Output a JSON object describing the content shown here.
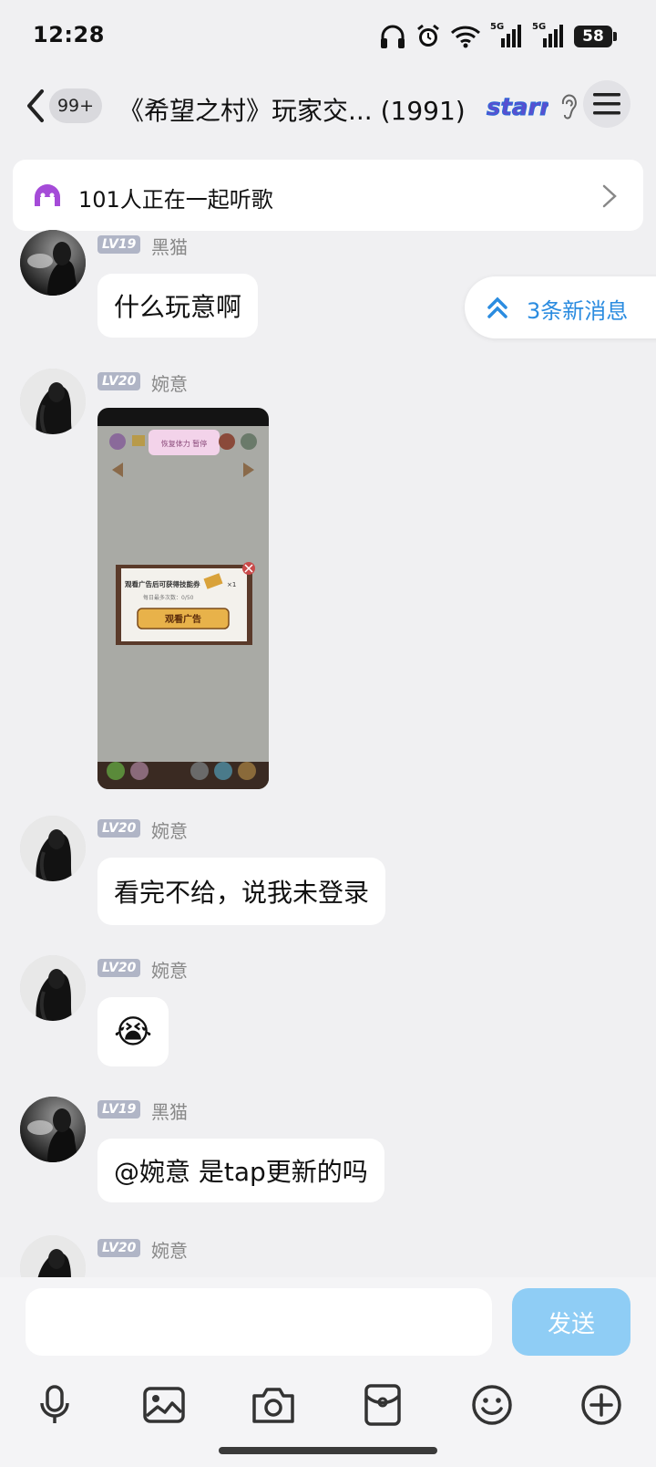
{
  "status_bar": {
    "time": "12:28",
    "network_1": "5G",
    "network_2": "5G",
    "battery": "58"
  },
  "header": {
    "unread_count": "99+",
    "title": "《希望之村》玩家交...   (1991)",
    "badge_text": "starry"
  },
  "listen_banner": {
    "text": "101人正在一起听歌"
  },
  "new_messages": {
    "text": "3条新消息"
  },
  "messages": [
    {
      "level": "LV19",
      "sender": "黑猫",
      "text": "什么玩意啊"
    },
    {
      "level": "LV20",
      "sender": "婉意",
      "image_caption": "观看广告后可获得技能券",
      "image_subcaption": "每日最多次数：0/50",
      "image_button": "观看广告",
      "image_reward": "×1",
      "image_top_label": "恢复体力 暂停"
    },
    {
      "level": "LV20",
      "sender": "婉意",
      "text": "看完不给，说我未登录"
    },
    {
      "level": "LV20",
      "sender": "婉意",
      "emoji": "😭"
    },
    {
      "level": "LV19",
      "sender": "黑猫",
      "text": "@婉意 是tap更新的吗"
    },
    {
      "level": "LV20",
      "sender": "婉意"
    }
  ],
  "input": {
    "value": "",
    "send_label": "发送"
  },
  "colors": {
    "background": "#f0f0f2",
    "accent_blue": "#2b8ce0",
    "send_button": "#8fcdf5",
    "level_badge": "#b0b5c6"
  },
  "icons": [
    "microphone-icon",
    "image-icon",
    "camera-icon",
    "red-packet-icon",
    "emoji-icon",
    "plus-icon"
  ]
}
